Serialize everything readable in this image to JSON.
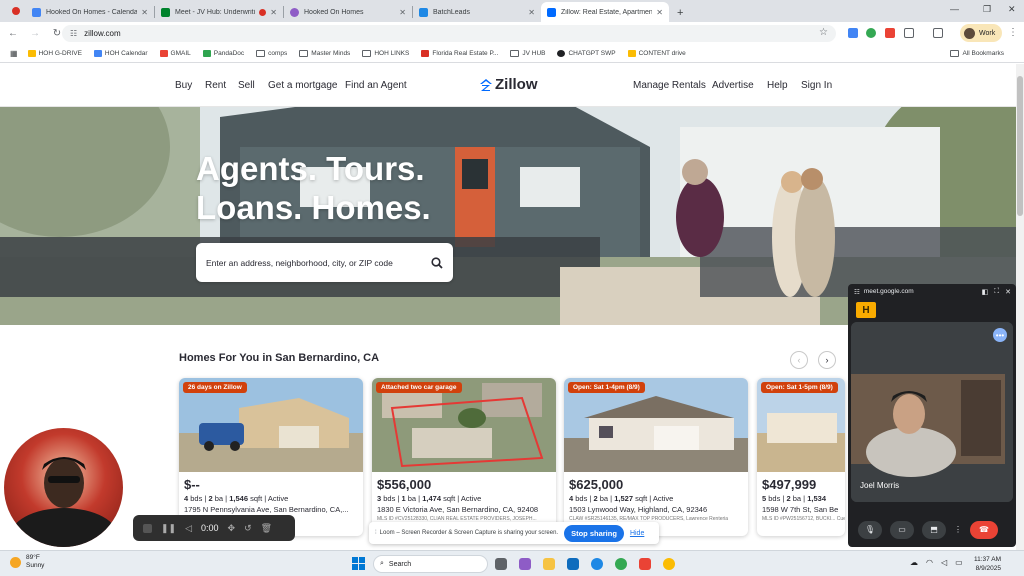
{
  "browser": {
    "tabs": [
      {
        "title": "Hooked On Homes - Calendar",
        "color": "#4285f4",
        "recording": false
      },
      {
        "title": "Meet - JV Hub: Underwriting",
        "color": "#00832d",
        "recording": true
      },
      {
        "title": "Hooked On Homes",
        "color": "#8e5cc6",
        "recording": false
      },
      {
        "title": "BatchLeads",
        "color": "#1e88e5",
        "recording": false
      },
      {
        "title": "Zillow: Real Estate, Apartments",
        "color": "#006aff",
        "recording": false
      }
    ],
    "url": "zillow.com",
    "profile_label": "Work",
    "bookmarks": [
      {
        "label": "HOH G-DRIVE",
        "icon": "drive-icon",
        "color": "#fbbc04"
      },
      {
        "label": "HOH Calendar",
        "icon": "calendar-icon",
        "color": "#4285f4"
      },
      {
        "label": "GMAIL",
        "icon": "gmail-icon",
        "color": "#ea4335"
      },
      {
        "label": "PandaDoc",
        "icon": "pandadoc-icon",
        "color": "#2ea44f"
      },
      {
        "label": "comps",
        "icon": "folder-icon",
        "color": ""
      },
      {
        "label": "Master Minds",
        "icon": "folder-icon",
        "color": ""
      },
      {
        "label": "HOH LINKS",
        "icon": "folder-icon",
        "color": ""
      },
      {
        "label": "Florida Real Estate P...",
        "icon": "florida-icon",
        "color": "#d93025"
      },
      {
        "label": "JV HUB",
        "icon": "folder-icon",
        "color": ""
      },
      {
        "label": "CHATGPT SWP",
        "icon": "chatgpt-icon",
        "color": "#202124"
      },
      {
        "label": "CONTENT drive",
        "icon": "drive-icon",
        "color": "#fbbc04"
      }
    ],
    "all_bookmarks_label": "All Bookmarks"
  },
  "zillow": {
    "nav_left": [
      "Buy",
      "Rent",
      "Sell",
      "Get a mortgage",
      "Find an Agent"
    ],
    "logo_text": "Zillow",
    "nav_right": [
      "Manage Rentals",
      "Advertise",
      "Help",
      "Sign In"
    ],
    "hero_line1": "Agents. Tours.",
    "hero_line2": "Loans. Homes.",
    "search_placeholder": "Enter an address, neighborhood, city, or ZIP code",
    "section_title": "Homes For You in San Bernardino, CA",
    "listings": [
      {
        "badge": "26 days on Zillow",
        "price": "$--",
        "beds": "4",
        "baths": "2",
        "sqft": "1,546",
        "status": "Active",
        "address": "1795 N Pennsylvania Ave, San Bernardino, CA,...",
        "mls": ""
      },
      {
        "badge": "Attached two car garage",
        "price": "$556,000",
        "beds": "3",
        "baths": "1",
        "sqft": "1,474",
        "status": "Active",
        "address": "1830 E Victoria Ave, San Bernardino, CA, 92408",
        "mls": "MLS ID #CV25128330, CLIAN REAL ESTATE PROVIDERS, JOSEPH..."
      },
      {
        "badge": "Open: Sat 1-4pm (8/9)",
        "price": "$625,000",
        "beds": "4",
        "baths": "2",
        "sqft": "1,527",
        "status": "Active",
        "address": "1503 Lynwood Way, Highland, CA, 92346",
        "mls": "CLAW #SR25146135, RE/MAX TOP PRODUCERS, Lawrence Renteria"
      },
      {
        "badge": "Open: Sat 1-5pm (8/9)",
        "price": "$497,999",
        "beds": "5",
        "baths": "2",
        "sqft": "1,534",
        "status": "",
        "address": "1598 W 7th St, San Be",
        "mls": "MLS ID #PW25156712, BUCKI... Cuellar"
      }
    ],
    "unit_bds": "bds",
    "unit_ba": "ba",
    "unit_sqft": "sqft"
  },
  "recorder": {
    "time": "0:00"
  },
  "share_bar": {
    "message": "Loom – Screen Recorder & Screen Capture is sharing your screen.",
    "stop_label": "Stop sharing",
    "hide_label": "Hide"
  },
  "meet": {
    "url": "meet.google.com",
    "participant": "Joel Morris",
    "logo_letter": "H"
  },
  "taskbar": {
    "temp": "89°F",
    "condition": "Sunny",
    "search_label": "Search",
    "time": "11:37 AM",
    "date": "8/9/2025"
  }
}
